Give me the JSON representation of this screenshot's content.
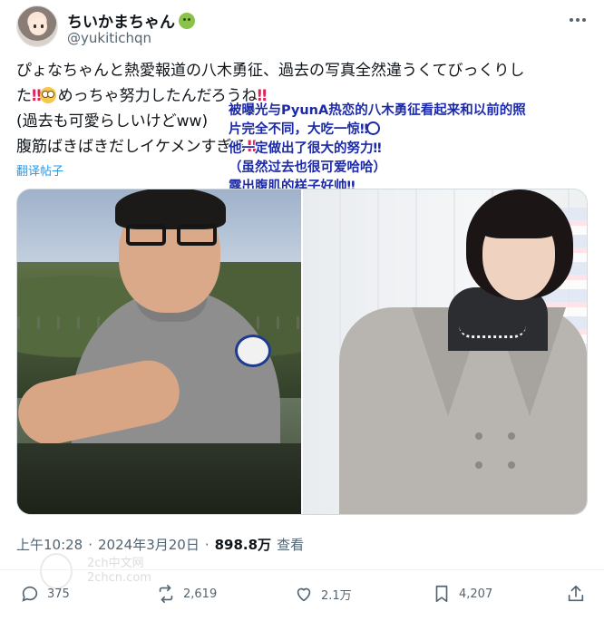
{
  "author": {
    "display_name": "ちいかまちゃん",
    "handle": "@yukitichqn",
    "badge_icon": "nauseated-face-icon"
  },
  "tweet": {
    "line1": "ぴょなちゃんと熱愛報道の八木勇征、過去の写真全然違うくてびっくりし",
    "line2_a": "た",
    "line2_bang": "‼",
    "line2_b": "めっちゃ努力したんだろうね",
    "line3": "(過去も可愛らしいけどww)",
    "line4": "腹筋ばきばきだしイケメンすぎる",
    "translate_link": "翻译帖子"
  },
  "overlay_translation": {
    "line1": "被曝光与PyunA热恋的八木勇征看起来和以前的照",
    "line2": "片完全不同，大吃一惊",
    "line3": "他一定做出了很大的努力",
    "line4": "（虽然过去也很可爱哈哈）",
    "line5": "露出腹肌的样子好帅",
    "bang": "‼",
    "color": "#1c2aa8"
  },
  "meta": {
    "time": "上午10:28",
    "dot": "·",
    "date": "2024年3月20日",
    "views_count": "898.8万",
    "views_label": "查看"
  },
  "watermark": {
    "line1": "2ch中文网",
    "line2": "2chcn.com"
  },
  "actions": {
    "reply_count": "375",
    "retweet_count": "2,619",
    "like_count": "2.1万",
    "bookmark_count": "4,207"
  },
  "colors": {
    "accent_link": "#1d9bf0",
    "secondary_text": "#536471",
    "exclamation": "#e0245e"
  }
}
